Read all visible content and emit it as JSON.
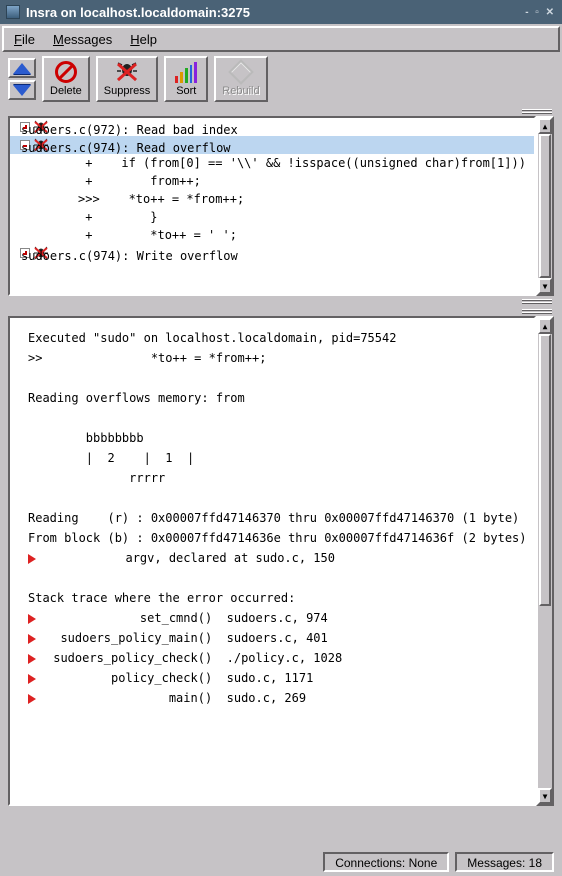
{
  "window": {
    "title": "Insra on localhost.localdomain:3275"
  },
  "menu": {
    "file": "File",
    "messages": "Messages",
    "help": "Help"
  },
  "toolbar": {
    "delete": "Delete",
    "suppress": "Suppress",
    "sort": "Sort",
    "rebuild": "Rebuild"
  },
  "top_list": [
    {
      "icon": "plus",
      "text": "sudoers.c(972): Read bad index",
      "selected": false
    },
    {
      "icon": "minus",
      "text": "sudoers.c(974): Read overflow",
      "selected": true
    },
    {
      "icon": "none",
      "text": " +    if (from[0] == '\\\\' && !isspace((unsigned char)from[1]))",
      "selected": false
    },
    {
      "icon": "none",
      "text": " +        from++;",
      "selected": false
    },
    {
      "icon": "none",
      "text": ">>>    *to++ = *from++;",
      "selected": false
    },
    {
      "icon": "none",
      "text": " +        }",
      "selected": false
    },
    {
      "icon": "none",
      "text": " +        *to++ = ' ';",
      "selected": false
    },
    {
      "icon": "plus",
      "text": "sudoers.c(974): Write overflow",
      "selected": false
    }
  ],
  "detail": {
    "exec": "Executed \"sudo\" on localhost.localdomain, pid=75542",
    "marker": ">>               *to++ = *from++;",
    "heading": "Reading overflows memory: from",
    "diagram": [
      "        bbbbbbbb",
      "        |  2    |  1  |",
      "              rrrrr"
    ],
    "reading": "Reading    (r) : 0x00007ffd47146370 thru 0x00007ffd47146370 (1 byte)",
    "fromblock": "From block (b) : 0x00007ffd4714636e thru 0x00007ffd4714636f (2 bytes)",
    "argv": "argv, declared at sudo.c, 150",
    "stack_heading": "Stack trace where the error occurred:",
    "stack": [
      "             set_cmnd()  sudoers.c, 974",
      "  sudoers_policy_main()  sudoers.c, 401",
      " sudoers_policy_check()  ./policy.c, 1028",
      "         policy_check()  sudo.c, 1171",
      "                 main()  sudo.c, 269"
    ]
  },
  "status": {
    "connections": "Connections: None",
    "messages": "Messages: 18"
  }
}
